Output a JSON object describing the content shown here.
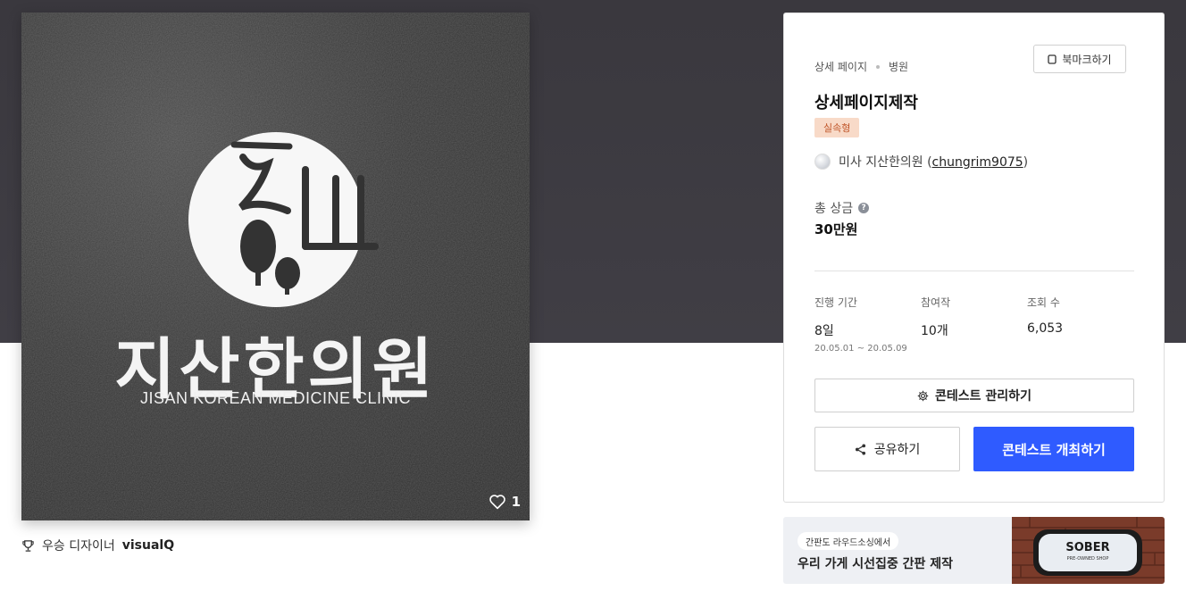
{
  "artwork": {
    "korean_name": "지산한의원",
    "english_name": "JISAN KOREAN MEDICINE CLINIC",
    "like_count": "1",
    "like_icon": "heart-outline-icon"
  },
  "designer": {
    "icon": "trophy-icon",
    "prefix": "우승 디자이너",
    "name": "visualQ"
  },
  "contest": {
    "breadcrumb": [
      "상세 페이지",
      "병원"
    ],
    "bookmark_label": "북마크하기",
    "title": "상세페이지제작",
    "tag": "실속형",
    "host_name": "미사 지산한의원",
    "host_handle": "chungrim9075",
    "prize_label": "총 상금",
    "prize_value": "30만원",
    "stats": [
      {
        "label": "진행 기간",
        "value": "8일",
        "sub": "20.05.01 ~ 20.05.09"
      },
      {
        "label": "참여작",
        "value": "10개",
        "sub": ""
      },
      {
        "label": "조회 수",
        "value": "6,053",
        "sub": ""
      }
    ],
    "manage_label": "콘테스트 관리하기",
    "share_label": "공유하기",
    "host_button_label": "콘테스트 개최하기",
    "accent": "#2f5bff",
    "tag_bg": "#f8dac8",
    "tag_color": "#c0562a"
  },
  "banner": {
    "pill": "간판도 라우드소싱에서",
    "headline": "우리 가게 시선집중 간판 제작",
    "sign_text": "SOBER",
    "sign_subtext": "PRE-OWNED SHOP"
  }
}
